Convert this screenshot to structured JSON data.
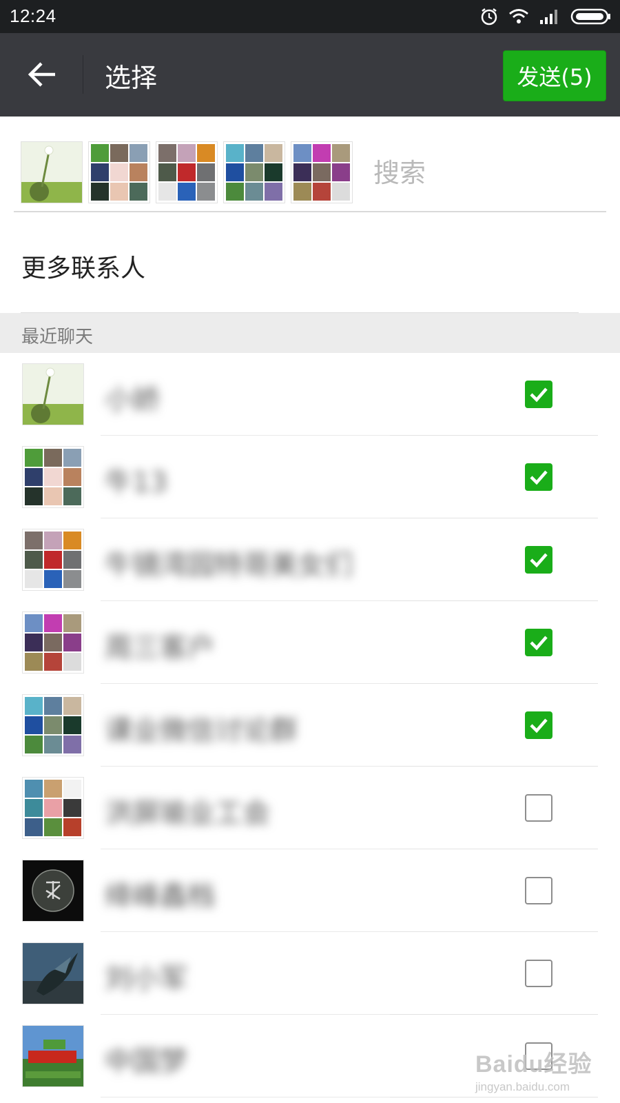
{
  "status_bar": {
    "time": "12:24",
    "icons": [
      "alarm-icon",
      "wifi-icon",
      "signal-icon",
      "battery-icon"
    ]
  },
  "header": {
    "title": "选择",
    "send_button": "发送(5)",
    "back_icon": "arrow-left-icon"
  },
  "selected": {
    "avatars": [
      "avatar-flower-photo",
      "avatar-group-grid",
      "avatar-group-grid",
      "avatar-group-grid",
      "avatar-group-grid"
    ],
    "search_placeholder": "搜索"
  },
  "more_contacts": {
    "label": "更多联系人"
  },
  "section": {
    "title": "最近聊天"
  },
  "chats": [
    {
      "name": "小娇",
      "checked": true
    },
    {
      "name": "牛13",
      "checked": true
    },
    {
      "name": "牛镜湾园特哥美女们",
      "checked": true
    },
    {
      "name": "周三客户",
      "checked": true
    },
    {
      "name": "课业微信讨论群",
      "checked": true
    },
    {
      "name": "洪屏瑜业工会",
      "checked": false
    },
    {
      "name": "绛峰鑫档",
      "checked": false
    },
    {
      "name": "刘小军",
      "checked": false
    },
    {
      "name": "中国梦",
      "checked": false
    }
  ],
  "colors": {
    "status_bar": "#1d1f21",
    "top_bar": "#393a3f",
    "accent_green": "#1aad19",
    "section_bg": "#ececec"
  },
  "watermark": {
    "brand": "Baidu经验",
    "url": "jingyan.baidu.com"
  }
}
